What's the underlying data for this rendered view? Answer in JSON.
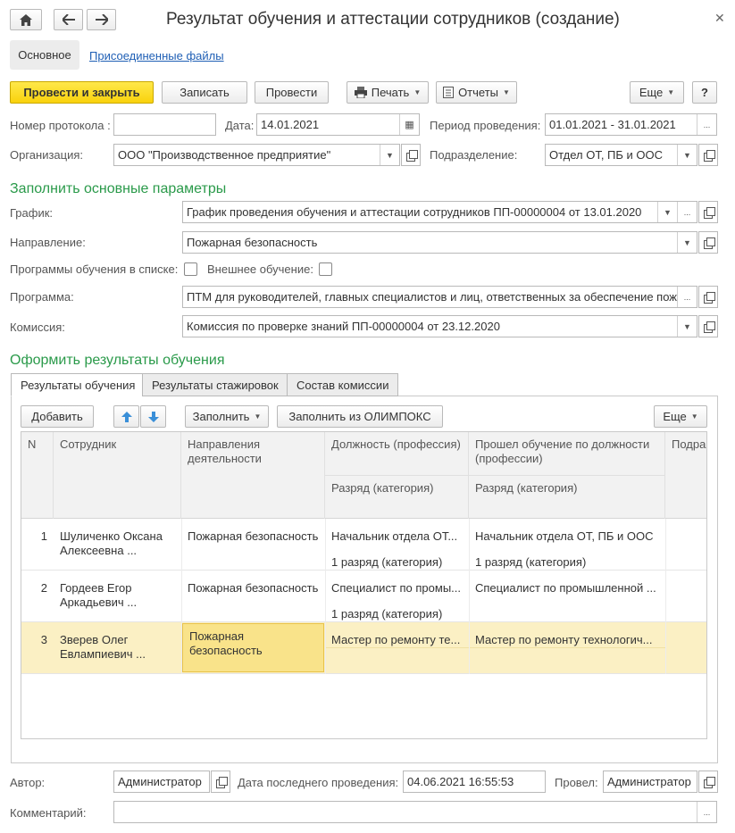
{
  "window": {
    "title": "Результат обучения и аттестации сотрудников (создание)"
  },
  "nav_tabs": {
    "main": "Основное",
    "files": "Присоединенные файлы"
  },
  "toolbar": {
    "post_close": "Провести и закрыть",
    "save": "Записать",
    "post": "Провести",
    "print": "Печать",
    "reports": "Отчеты",
    "more": "Еще",
    "help": "?"
  },
  "form": {
    "protocol_label": "Номер протокола :",
    "protocol_value": "",
    "date_label": "Дата:",
    "date_value": "14.01.2021",
    "period_label": "Период проведения:",
    "period_value": "01.01.2021 - 31.01.2021",
    "org_label": "Организация:",
    "org_value": "ООО \"Производственное предприятие\"",
    "dept_label": "Подразделение:",
    "dept_value": "Отдел ОТ, ПБ и ООС"
  },
  "params": {
    "heading": "Заполнить основные параметры",
    "schedule_label": "График:",
    "schedule_value": "График проведения обучения и аттестации сотрудников ПП-00000004 от 13.01.2020",
    "direction_label": "Направление:",
    "direction_value": "Пожарная безопасность",
    "programs_in_list_label": "Программы обучения в списке:",
    "external_label": "Внешнее обучение:",
    "program_label": "Программа:",
    "program_value": "ПТМ для руководителей, главных специалистов и лиц, ответственных за обеспечение пожарной безопасности",
    "commission_label": "Комиссия:",
    "commission_value": "Комиссия по проверке знаний ПП-00000004 от 23.12.2020"
  },
  "results": {
    "heading": "Оформить результаты обучения",
    "tabs": [
      "Результаты обучения",
      "Результаты стажировок",
      "Состав комиссии"
    ],
    "add": "Добавить",
    "fill": "Заполнить",
    "fill_olimpox": "Заполнить из ОЛИМПОКС",
    "more": "Еще"
  },
  "table": {
    "headers": {
      "n": "N",
      "employee": "Сотрудник",
      "direction": "Направления деятельности",
      "position": "Должность (профессия)",
      "trained": "Прошел обучение по должности (профессии)",
      "rank1": "Разряд (категория)",
      "rank2": "Разряд (категория)",
      "dept": "Подра"
    },
    "rows": [
      {
        "n": "1",
        "employee": "Шуличенко Оксана Алексеевна ...",
        "direction": "Пожарная безопасность",
        "position": "Начальник отдела ОТ...",
        "position_rank": "1 разряд (категория)",
        "trained": "Начальник отдела ОТ, ПБ и ООС",
        "trained_rank": "1 разряд (категория)"
      },
      {
        "n": "2",
        "employee": "Гордеев Егор Аркадьевич ...",
        "direction": "Пожарная безопасность",
        "position": "Специалист по промы...",
        "position_rank": "1 разряд (категория)",
        "trained": "Специалист по промышленной ...",
        "trained_rank": ""
      },
      {
        "n": "3",
        "employee": "Зверев Олег Евлампиевич ...",
        "direction": "Пожарная безопасность",
        "position": "Мастер по ремонту те...",
        "position_rank": "",
        "trained": "Мастер по ремонту технологич...",
        "trained_rank": ""
      }
    ]
  },
  "footer": {
    "author_label": "Автор:",
    "author_value": "Администратор",
    "last_post_label": "Дата последнего проведения:",
    "last_post_value": "04.06.2021 16:55:53",
    "posted_by_label": "Провел:",
    "posted_by_value": "Администратор",
    "comment_label": "Комментарий:",
    "comment_value": ""
  }
}
